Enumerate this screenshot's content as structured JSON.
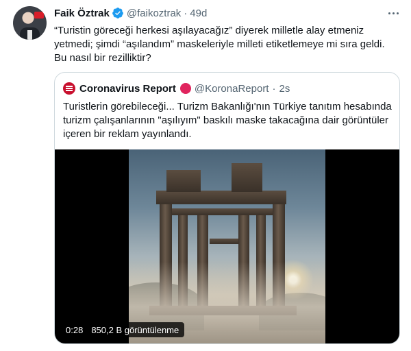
{
  "tweet": {
    "author_name": "Faik Öztrak",
    "author_handle": "@faikoztrak",
    "separator": "·",
    "time": "49d",
    "text": "“Turistin göreceği herkesi aşılayacağız” diyerek milletle alay etmeniz yetmedi; şimdi “aşılandım” maskeleriyle milleti etiketlemeye mi sıra geldi. Bu nasıl bir rezilliktir?"
  },
  "quoted": {
    "author_name": "Coronavirus Report",
    "author_handle": "@KoronaReport",
    "separator": "·",
    "time": "2s",
    "text": "Turistlerin görebileceği... Turizm Bakanlığı'nın Türkiye tanıtım hesabında turizm çalışanlarının \"aşılıyım\" baskılı maske takacağına dair görüntüler içeren bir reklam yayınlandı.",
    "video": {
      "duration": "0:28",
      "views": "850,2 B görüntülenme"
    }
  },
  "colors": {
    "verified": "#1d9bf0",
    "secondary_text": "#536471",
    "border": "#cfd9de"
  },
  "icons": [
    "verified-badge-icon",
    "more-icon",
    "red-circle-badge-icon"
  ]
}
